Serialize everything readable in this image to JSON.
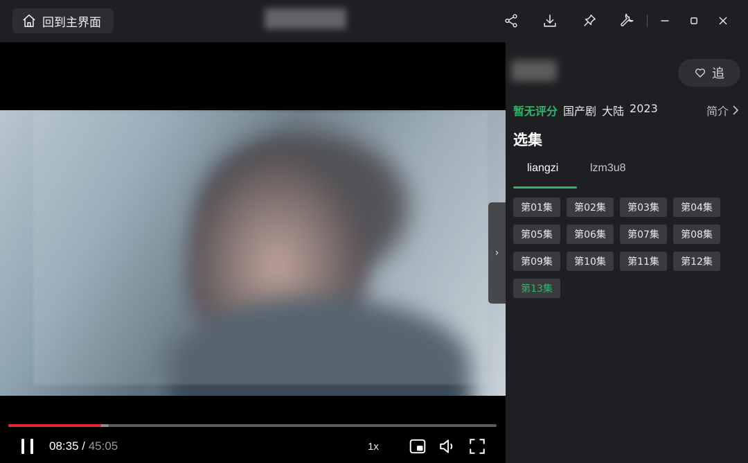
{
  "titlebar": {
    "home_label": "回到主界面",
    "icons": [
      "share-icon",
      "download-icon",
      "pin-icon",
      "wrench-icon",
      "minimize-icon",
      "maximize-icon",
      "close-icon"
    ]
  },
  "player": {
    "current_time": "08:35",
    "separator": " / ",
    "duration": "45:05",
    "progress_fraction": 0.19,
    "buffered_fraction": 0.205,
    "speed": "1x",
    "side_toggle": "›"
  },
  "panel": {
    "follow_label": "追",
    "rating": "暂无评分",
    "tags": [
      "国产剧",
      "大陆",
      "2023"
    ],
    "intro_label": "简介",
    "section_title": "选集",
    "sources": [
      {
        "label": "liangzi",
        "active": true
      },
      {
        "label": "lzm3u8",
        "active": false
      }
    ],
    "episodes": [
      "第01集",
      "第02集",
      "第03集",
      "第04集",
      "第05集",
      "第06集",
      "第07集",
      "第08集",
      "第09集",
      "第10集",
      "第11集",
      "第12集",
      "第13集"
    ],
    "current_episode_index": 12
  },
  "colors": {
    "accent_green": "#2fb56a",
    "progress_red": "#e3262c",
    "background": "#1e1f22",
    "episode_button": "#3a3b3f"
  }
}
